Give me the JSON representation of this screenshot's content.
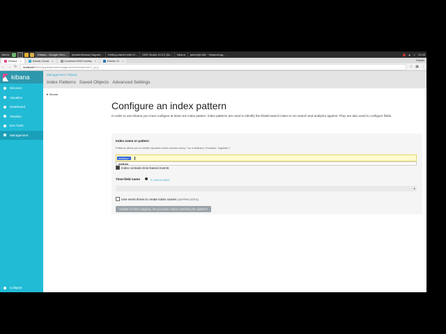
{
  "taskbar": {
    "menu_label": "Menu",
    "windows": [
      "Kibana - Google Chro...",
      "[elastic/kibana] Vagrant...",
      "Getting started with Ki...",
      "OBS Studio 19.0.2 (lin...",
      "kibana",
      "james@LAB: ~/kibana/vag..."
    ],
    "clock": "19:48"
  },
  "browser": {
    "tabs": [
      "Kibana",
      "Elastic Cloud",
      "localhost:5000/?pretty",
      "Elastic UI"
    ],
    "user": "Elastic",
    "url_host": "localhost",
    "url_path": ":5601/app/kibana#/management/kibana/index?_g=()"
  },
  "kibana": {
    "logo_text": "kibana",
    "nav": [
      "Discover",
      "Visualize",
      "Dashboard",
      "Timelion",
      "Dev Tools",
      "Management"
    ],
    "collapse": "Collapse",
    "breadcrumb": [
      "Management",
      "Kibana"
    ],
    "subtabs": [
      "Index Patterns",
      "Saved Objects",
      "Advanced Settings"
    ],
    "left_panel_item": "Kibana"
  },
  "page": {
    "title": "Configure an index pattern",
    "description": "In order to use Kibana you must configure at least one index pattern. Index patterns are used to identify the Elasticsearch index to run search and analytics against. They are also used to configure fields.",
    "index_label": "Index name or pattern",
    "index_help": "Patterns allow you to define dynamic index names using * as a wildcard. Example: logstash-*",
    "index_value": "metrics-*",
    "suggestion": "metrics",
    "time_based_label": "Index contains time-based events",
    "time_field_label": "Time-field name",
    "refresh_label": "refresh fields",
    "event_times_label": "Use event times to create index names",
    "deprecated": "[DEPRECATED]",
    "button": "Unable to fetch mapping. Do you have indices matching the pattern?"
  }
}
